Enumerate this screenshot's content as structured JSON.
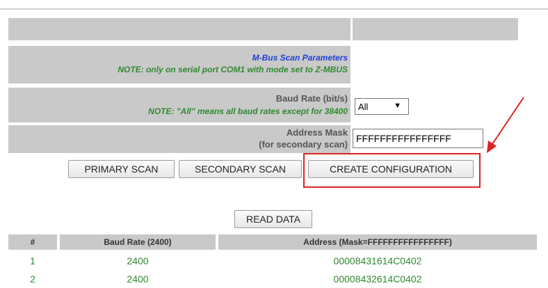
{
  "params": {
    "title": "M-Bus Scan Parameters",
    "note": "NOTE: only on serial port COM1 with mode set to Z-MBUS",
    "baud_label": "Baud Rate (bit/s)",
    "baud_note": "NOTE: \"All\" means all baud rates except for 38400",
    "baud_value": "All",
    "address_mask_label": "Address Mask",
    "address_mask_sublabel": "(for secondary scan)",
    "address_mask_value": "FFFFFFFFFFFFFFFF"
  },
  "buttons": {
    "primary_scan": "PRIMARY SCAN",
    "secondary_scan": "SECONDARY SCAN",
    "create_configuration": "CREATE CONFIGURATION",
    "read_data": "READ DATA"
  },
  "results": {
    "headers": [
      "#",
      "Baud Rate (2400)",
      "Address (Mask=FFFFFFFFFFFFFFFF)"
    ],
    "rows": [
      [
        "1",
        "2400",
        "00008431614C0402"
      ],
      [
        "2",
        "2400",
        "00008432614C0402"
      ]
    ]
  },
  "colors": {
    "title": "#1f3fd6",
    "note": "#2f8a2f",
    "highlight": "#e02121"
  }
}
